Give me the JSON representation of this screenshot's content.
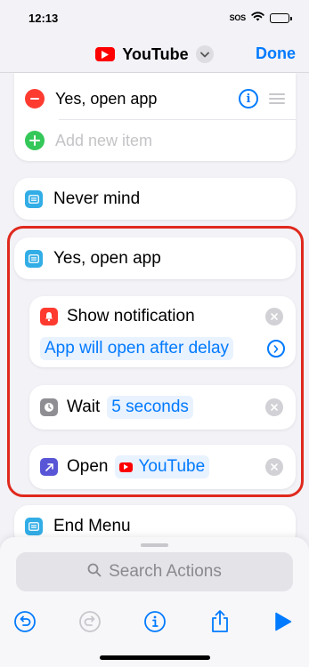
{
  "status_bar": {
    "time": "12:13",
    "sos": "SOS"
  },
  "nav": {
    "title": "YouTube",
    "done_label": "Done"
  },
  "menu_block": {
    "item_label": "Yes, open app",
    "add_placeholder": "Add new item"
  },
  "blocks": {
    "never_mind": "Never mind",
    "yes_open_app": "Yes, open app",
    "end_menu": "End Menu"
  },
  "actions": {
    "show_notification": {
      "label": "Show notification",
      "param": "App will open after delay"
    },
    "wait": {
      "label": "Wait",
      "param": "5 seconds"
    },
    "open": {
      "label": "Open",
      "param": "YouTube"
    }
  },
  "search": {
    "placeholder": "Search Actions"
  },
  "colors": {
    "accent": "#007aff",
    "highlight_border": "#e0291d",
    "youtube_red": "#ff0000",
    "menu_icon": "#32ade6",
    "notification_icon": "#ff3b30",
    "wait_icon": "#8e8e93",
    "open_icon": "#5856d6",
    "remove": "#ff3b30",
    "add": "#34c759"
  },
  "icons": {
    "toolbar": [
      "undo-icon",
      "redo-icon",
      "info-icon",
      "share-icon",
      "play-icon"
    ]
  }
}
